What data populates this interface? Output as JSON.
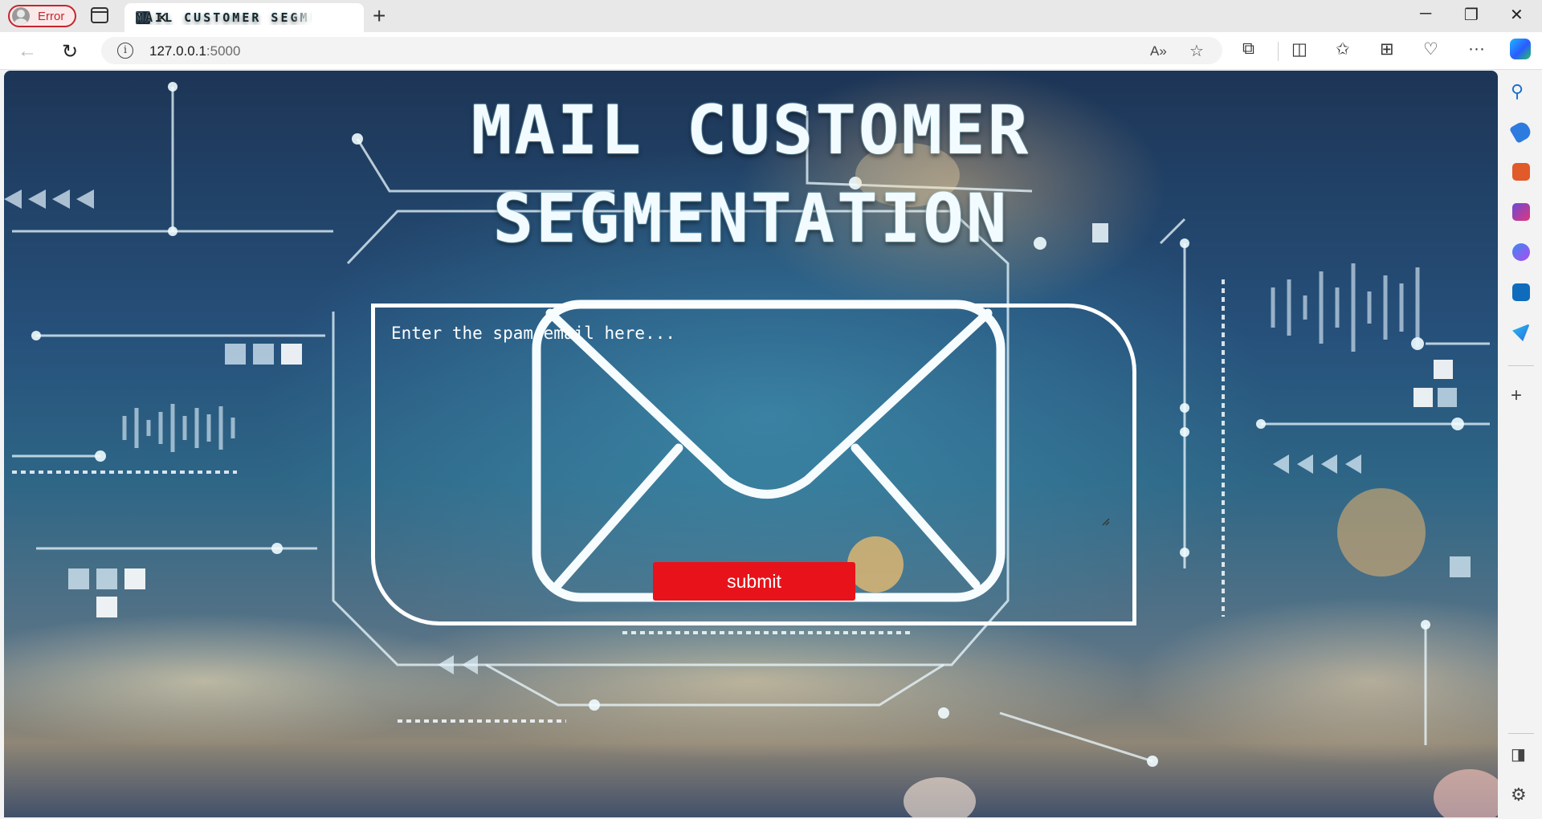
{
  "browser": {
    "profile_label": "Error",
    "tab_title": "MAIL CUSTOMER SEGMENTATION",
    "url_host": "127.0.0.1",
    "url_port": ":5000"
  },
  "page": {
    "title_line1": "MAIL CUSTOMER",
    "title_line2": "SEGMENTATION",
    "email_placeholder": "Enter the spam email here...",
    "submit_label": "submit"
  },
  "colors": {
    "submit_bg": "#e8121a",
    "title_text": "#f2fbff",
    "profile_border": "#c4262e"
  },
  "icons": {
    "tabbar": [
      "avatar-icon",
      "tab-actions-icon",
      "terminal-favicon-icon",
      "close-icon",
      "plus-icon",
      "minimize-icon",
      "restore-icon",
      "close-window-icon"
    ],
    "toolbar": [
      "back-icon",
      "refresh-icon",
      "info-icon",
      "read-aloud-icon",
      "favorite-star-icon",
      "extensions-icon",
      "split-screen-icon",
      "favorites-icon",
      "collections-icon",
      "browser-essentials-icon",
      "more-icon",
      "copilot-icon"
    ],
    "sidebar": [
      "search-icon",
      "shopping-tag-icon",
      "tools-icon",
      "games-icon",
      "microsoft365-icon",
      "outlook-icon",
      "send-icon",
      "add-icon",
      "sidebar-toggle-icon",
      "settings-icon"
    ]
  }
}
